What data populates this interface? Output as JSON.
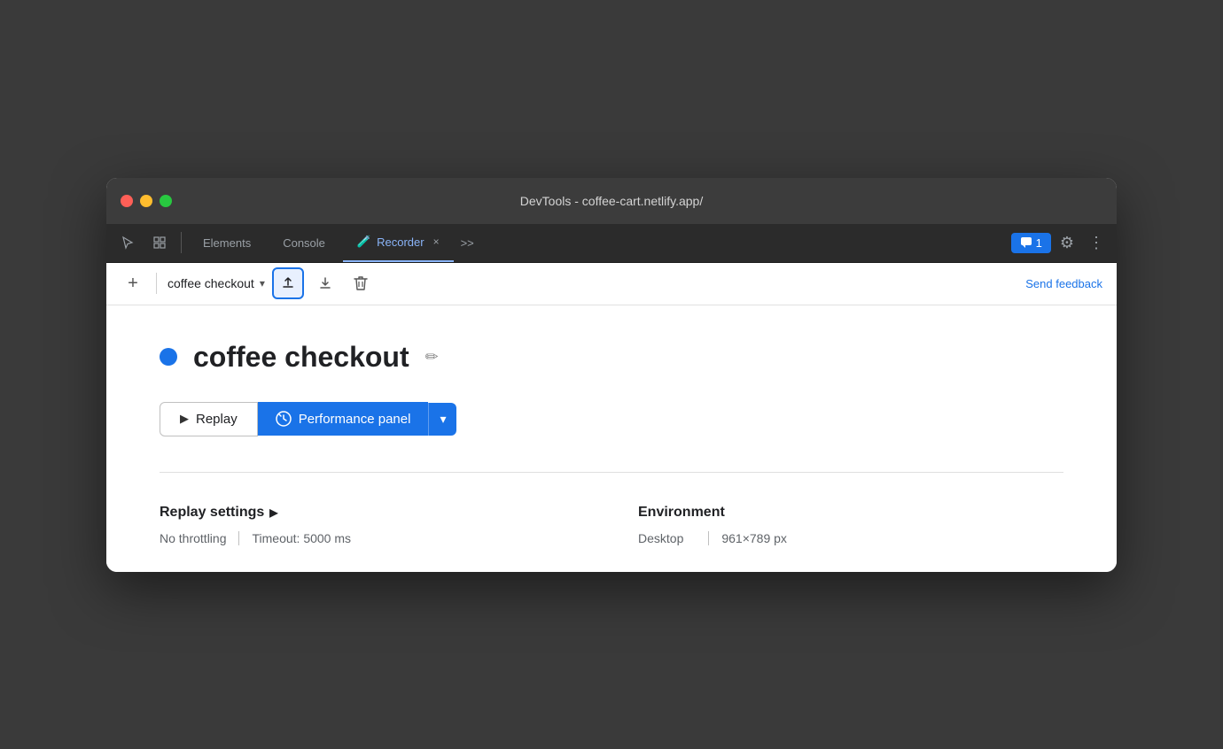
{
  "titleBar": {
    "title": "DevTools - coffee-cart.netlify.app/"
  },
  "tabs": {
    "left_icons": [
      "cursor-icon",
      "layers-icon"
    ],
    "items": [
      {
        "label": "Elements",
        "active": false
      },
      {
        "label": "Console",
        "active": false
      },
      {
        "label": "Recorder",
        "active": true
      },
      {
        "label": ">>",
        "active": false
      }
    ],
    "recorder_icon": "🧪",
    "close_label": "×",
    "more_label": ">>",
    "feedback_count": "1",
    "settings_icon": "⚙",
    "more_icon": "⋮"
  },
  "toolbar": {
    "add_label": "+",
    "recording_name": "coffee checkout",
    "dropdown_arrow": "▾",
    "export_icon": "⬆",
    "import_icon": "⬇",
    "delete_icon": "🗑",
    "send_feedback_label": "Send feedback"
  },
  "main": {
    "recording_title": "coffee checkout",
    "edit_icon": "✏",
    "replay_label": "Replay",
    "replay_play": "▶",
    "performance_label": "Performance panel",
    "performance_icon": "⏱",
    "performance_dropdown": "▾",
    "settings_heading": "Replay settings",
    "settings_arrow": "▶",
    "throttling_label": "No throttling",
    "timeout_label": "Timeout: 5000 ms",
    "environment_heading": "Environment",
    "environment_type": "Desktop",
    "environment_size": "961×789 px"
  }
}
